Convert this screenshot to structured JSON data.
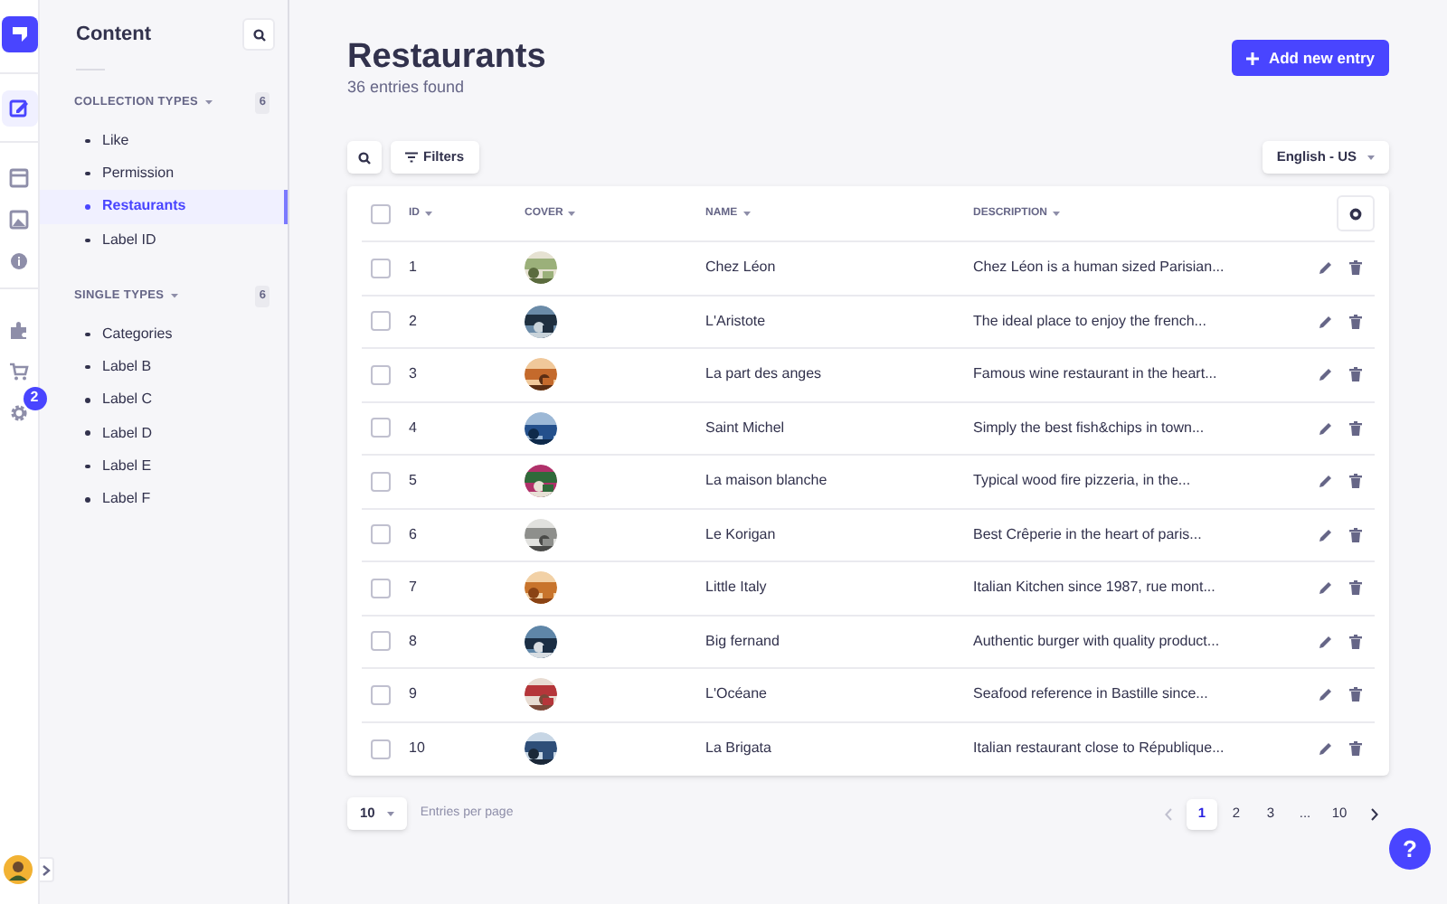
{
  "nav": {
    "items": [
      {
        "kind": "logo",
        "selected": false
      },
      {
        "kind": "edit",
        "selected": true
      },
      {
        "kind": "layout",
        "selected": false
      },
      {
        "kind": "media",
        "selected": false
      },
      {
        "kind": "info",
        "selected": false
      },
      {
        "kind": "puzzle",
        "selected": false
      },
      {
        "kind": "cart",
        "selected": false
      },
      {
        "kind": "gear",
        "selected": false,
        "badge": "2"
      }
    ]
  },
  "sidebar": {
    "title": "Content",
    "sections": [
      {
        "heading": "COLLECTION TYPES",
        "count": "6",
        "items": [
          {
            "label": "Like",
            "selected": false
          },
          {
            "label": "Permission",
            "selected": false
          },
          {
            "label": "Restaurants",
            "selected": true
          },
          {
            "label": "Label ID",
            "selected": false
          }
        ]
      },
      {
        "heading": "SINGLE TYPES",
        "count": "6",
        "items": [
          {
            "label": "Categories",
            "selected": false
          },
          {
            "label": "Label B",
            "selected": false
          },
          {
            "label": "Label C",
            "selected": false
          },
          {
            "label": "Label D",
            "selected": false
          },
          {
            "label": "Label E",
            "selected": false
          },
          {
            "label": "Label F",
            "selected": false
          }
        ]
      }
    ]
  },
  "header": {
    "title": "Restaurants",
    "subtitle": "36 entries found",
    "add_button": "Add new entry"
  },
  "toolbar": {
    "filters": "Filters",
    "locale": "English - US"
  },
  "table": {
    "all_checked": false,
    "columns": [
      "ID",
      "COVER",
      "NAME",
      "DESCRIPTION"
    ],
    "rows": [
      {
        "id": "1",
        "name": "Chez Léon",
        "description": "Chez Léon is a human sized Parisian...",
        "checked": false
      },
      {
        "id": "2",
        "name": "L'Aristote",
        "description": "The ideal place to enjoy the french...",
        "checked": false
      },
      {
        "id": "3",
        "name": "La part des anges",
        "description": "Famous wine restaurant in the heart...",
        "checked": false
      },
      {
        "id": "4",
        "name": "Saint Michel",
        "description": "Simply the best fish&chips in town...",
        "checked": false
      },
      {
        "id": "5",
        "name": "La maison blanche",
        "description": "Typical wood fire pizzeria, in the...",
        "checked": false
      },
      {
        "id": "6",
        "name": "Le Korigan",
        "description": "Best Crêperie in the heart of paris...",
        "checked": false
      },
      {
        "id": "7",
        "name": "Little Italy",
        "description": "Italian Kitchen since 1987, rue mont...",
        "checked": false
      },
      {
        "id": "8",
        "name": "Big fernand",
        "description": "Authentic burger with quality product...",
        "checked": false
      },
      {
        "id": "9",
        "name": "L'Océane",
        "description": "Seafood reference in Bastille since...",
        "checked": false
      },
      {
        "id": "10",
        "name": "La Brigata",
        "description": "Italian restaurant close to République...",
        "checked": false
      }
    ]
  },
  "footer": {
    "per_page": "10",
    "per_page_label": "Entries per page",
    "pages": [
      {
        "label": "1",
        "selected": true
      },
      {
        "label": "2",
        "selected": false
      },
      {
        "label": "3",
        "selected": false
      },
      {
        "label": "...",
        "selected": false
      },
      {
        "label": "10",
        "selected": false
      }
    ]
  },
  "help_button": "?"
}
